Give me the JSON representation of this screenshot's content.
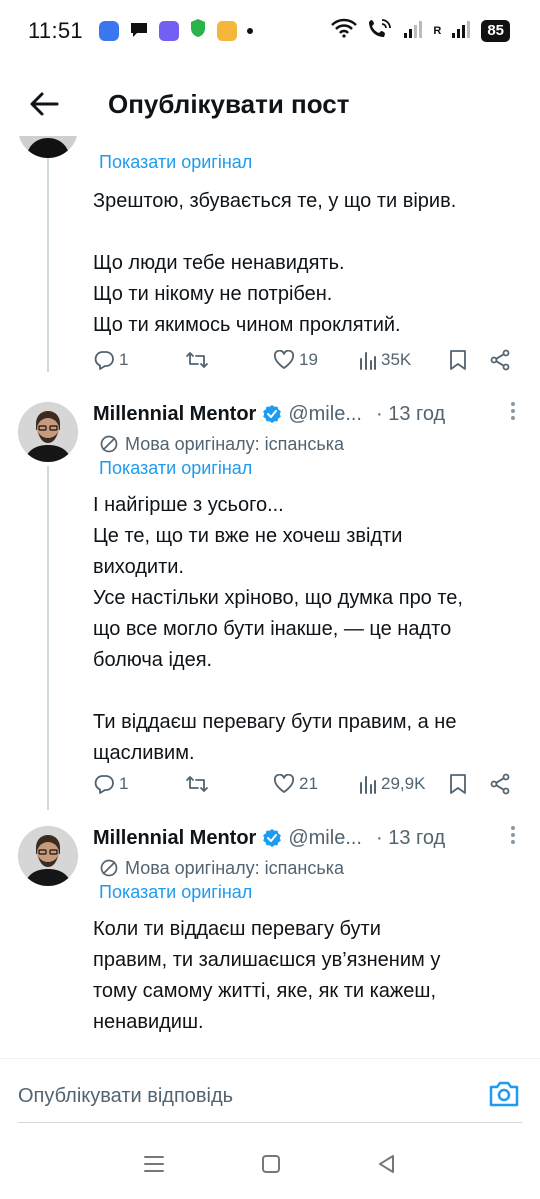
{
  "status_bar": {
    "time": "11:51",
    "signal_label": "R",
    "battery": "85"
  },
  "header": {
    "title": "Опублікувати пост"
  },
  "tweets": [
    {
      "show_original": "Показати оригінал",
      "paragraphs": [
        [
          "Зрештою, збувається те, у що ти вірив."
        ],
        [
          "Що люди тебе ненавидять.",
          "Що ти нікому не потрібен.",
          "Що ти якимось чином проклятий."
        ]
      ],
      "replies": "1",
      "likes": "19",
      "views": "35K"
    },
    {
      "name": "Millennial Mentor",
      "handle": "@mile...",
      "time": "· 13 год",
      "lang_note": "Мова оригіналу: іспанська",
      "show_original": "Показати оригінал",
      "paragraphs": [
        [
          "І найгірше з усього...",
          "Це те, що ти вже не хочеш звідти",
          "виходити.",
          "Усе настільки хріново, що думка про те,",
          "що все могло бути інакше, — це надто",
          "болюча ідея."
        ],
        [
          "Ти віддаєш перевагу бути правим, а не",
          "щасливим."
        ]
      ],
      "replies": "1",
      "likes": "21",
      "views": "29,9K"
    },
    {
      "name": "Millennial Mentor",
      "handle": "@mile...",
      "time": "· 13 год",
      "lang_note": "Мова оригіналу: іспанська",
      "show_original": "Показати оригінал",
      "paragraphs": [
        [
          "Коли ти віддаєш перевагу бути",
          "правим, ти залишаєшся ув’язненим у",
          "тому самому житті, яке, як ти кажеш,",
          "ненавидиш."
        ]
      ]
    }
  ],
  "reply_bar": {
    "placeholder": "Опублікувати відповідь"
  },
  "colors": {
    "accent": "#1d9bf0",
    "text": "#0f1419",
    "muted": "#536471",
    "line": "#cfd9de"
  }
}
